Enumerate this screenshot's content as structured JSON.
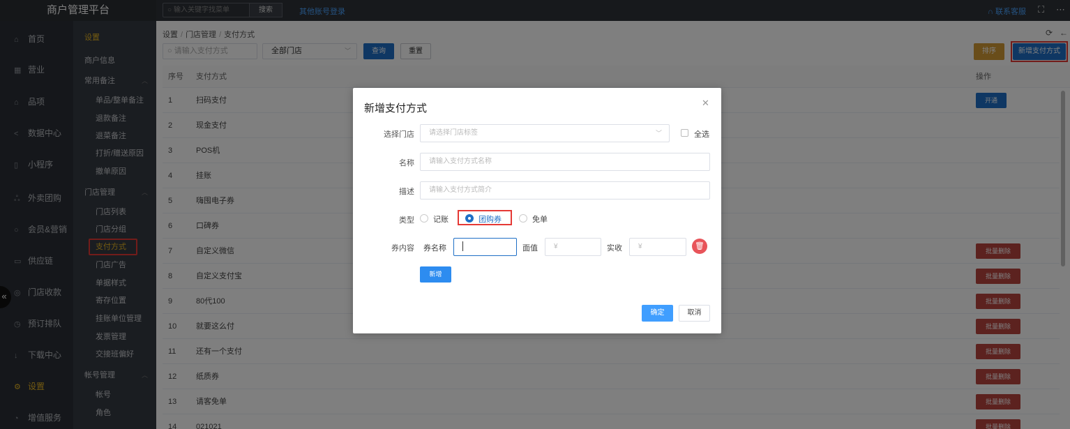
{
  "app": {
    "title": "商户管理平台"
  },
  "topbar": {
    "search_placeholder": "输入关键字找菜单",
    "search_btn": "搜索",
    "other_login": "其他账号登录",
    "contact": "联系客服"
  },
  "leftnav": [
    {
      "label": "首页",
      "icon": "home-icon"
    },
    {
      "label": "营业",
      "icon": "calendar-icon"
    },
    {
      "label": "品项",
      "icon": "bag-icon"
    },
    {
      "label": "数据中心",
      "icon": "share-icon"
    },
    {
      "label": "小程序",
      "icon": "phone-icon"
    },
    {
      "label": "外卖团购",
      "icon": "people-icon"
    },
    {
      "label": "会员&营销",
      "icon": "user-icon"
    },
    {
      "label": "供应链",
      "icon": "truck-icon"
    },
    {
      "label": "门店收款",
      "icon": "money-icon"
    },
    {
      "label": "预订排队",
      "icon": "clock-icon"
    },
    {
      "label": "下载中心",
      "icon": "download-icon"
    },
    {
      "label": "设置",
      "icon": "gear-icon",
      "active": true
    },
    {
      "label": "增值服务",
      "icon": "bell-icon"
    }
  ],
  "subnav": [
    {
      "label": "设置",
      "kind": "hdr"
    },
    {
      "label": "商户信息",
      "kind": "grp"
    },
    {
      "label": "常用备注",
      "kind": "grp",
      "arrow": "^"
    },
    {
      "label": "单品/整单备注",
      "kind": "item"
    },
    {
      "label": "退款备注",
      "kind": "item"
    },
    {
      "label": "退菜备注",
      "kind": "item"
    },
    {
      "label": "打折/赠送原因",
      "kind": "item"
    },
    {
      "label": "撤单原因",
      "kind": "item"
    },
    {
      "label": "门店管理",
      "kind": "grp",
      "arrow": "^"
    },
    {
      "label": "门店列表",
      "kind": "item"
    },
    {
      "label": "门店分组",
      "kind": "item"
    },
    {
      "label": "支付方式",
      "kind": "item",
      "selected": true
    },
    {
      "label": "门店广告",
      "kind": "item"
    },
    {
      "label": "单据样式",
      "kind": "item"
    },
    {
      "label": "寄存位置",
      "kind": "item"
    },
    {
      "label": "挂账单位管理",
      "kind": "item"
    },
    {
      "label": "发票管理",
      "kind": "item"
    },
    {
      "label": "交接班偏好",
      "kind": "item"
    },
    {
      "label": "帐号管理",
      "kind": "grp",
      "arrow": "^"
    },
    {
      "label": "帐号",
      "kind": "item"
    },
    {
      "label": "角色",
      "kind": "item"
    }
  ],
  "breadcrumb": [
    "设置",
    "门店管理",
    "支付方式"
  ],
  "filters": {
    "name_placeholder": "请输入支付方式",
    "store_value": "全部门店",
    "query": "查询",
    "reset": "重置",
    "sort": "排序",
    "add": "新增支付方式"
  },
  "table": {
    "headers": [
      "序号",
      "支付方式",
      "操作"
    ],
    "rows": [
      {
        "no": "1",
        "name": "扫码支付",
        "op": "开通"
      },
      {
        "no": "2",
        "name": "现金支付",
        "op": ""
      },
      {
        "no": "3",
        "name": "POS机",
        "op": ""
      },
      {
        "no": "4",
        "name": "挂账",
        "op": ""
      },
      {
        "no": "5",
        "name": "嗨囤电子券",
        "op": ""
      },
      {
        "no": "6",
        "name": "口碑券",
        "op": ""
      },
      {
        "no": "7",
        "name": "自定义微信",
        "op": "批量删除"
      },
      {
        "no": "8",
        "name": "自定义支付宝",
        "op": "批量删除"
      },
      {
        "no": "9",
        "name": "80代100",
        "op": "批量删除"
      },
      {
        "no": "10",
        "name": "就要这么付",
        "op": "批量删除"
      },
      {
        "no": "11",
        "name": "还有一个支付",
        "op": "批量删除"
      },
      {
        "no": "12",
        "name": "纸质券",
        "op": "批量删除"
      },
      {
        "no": "13",
        "name": "请客免单",
        "op": "批量删除"
      },
      {
        "no": "14",
        "name": "021021",
        "op": "批量删除"
      }
    ]
  },
  "modal": {
    "title": "新增支付方式",
    "store_label": "选择门店",
    "store_placeholder": "请选择门店标签",
    "all_label": "全选",
    "name_label": "名称",
    "name_placeholder": "请输入支付方式名称",
    "desc_label": "描述",
    "desc_placeholder": "请输入支付方式简介",
    "type_label": "类型",
    "type_options": [
      "记账",
      "团购券",
      "免单"
    ],
    "type_selected": "团购券",
    "voucher_label": "券内容",
    "voucher_name_label": "券名称",
    "face_label": "面值",
    "face_placeholder": "¥",
    "paid_label": "实收",
    "paid_placeholder": "¥",
    "new_btn": "新增",
    "ok_btn": "确定",
    "cancel_btn": "取消"
  }
}
